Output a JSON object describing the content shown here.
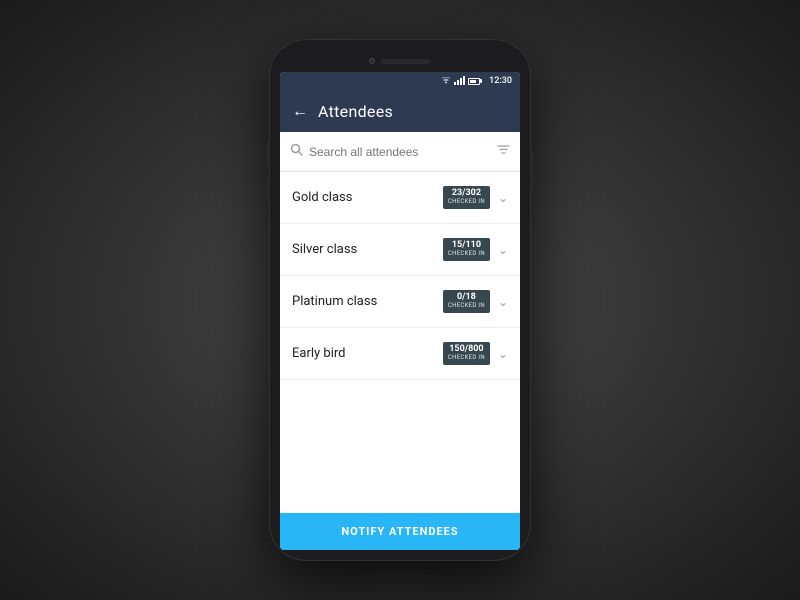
{
  "statusBar": {
    "time": "12:30"
  },
  "appBar": {
    "title": "Attendees",
    "backLabel": "←"
  },
  "search": {
    "placeholder": "Search all attendees"
  },
  "attendeeGroups": [
    {
      "label": "Gold class",
      "count": "23/302",
      "checkedInLabel": "CHECKED IN"
    },
    {
      "label": "Silver class",
      "count": "15/110",
      "checkedInLabel": "CHECKED IN"
    },
    {
      "label": "Platinum class",
      "count": "0/18",
      "checkedInLabel": "CHECKED IN"
    },
    {
      "label": "Early bird",
      "count": "150/800",
      "checkedInLabel": "CHECKED IN"
    }
  ],
  "notifyButton": {
    "label": "NOTIFY ATTENDEES"
  }
}
